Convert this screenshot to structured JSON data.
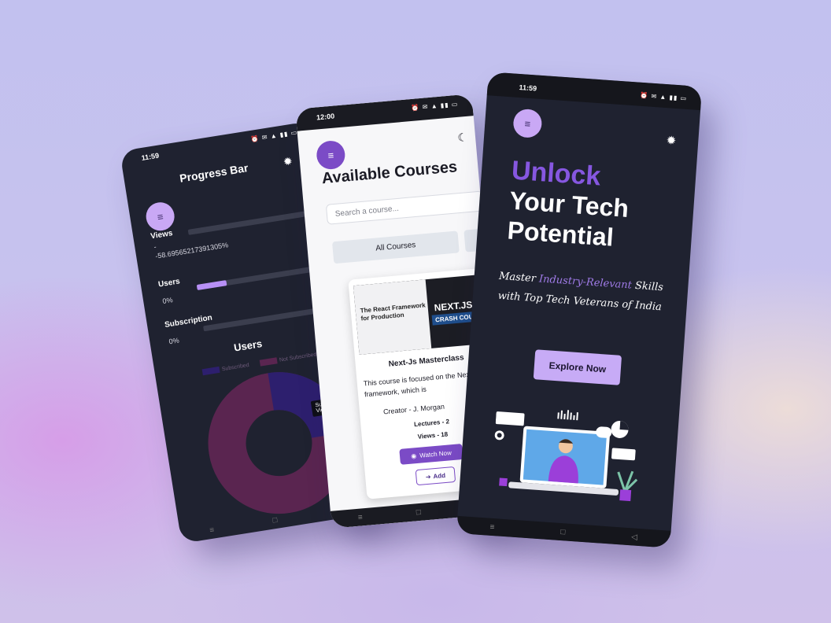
{
  "progress_phone": {
    "time": "11:59",
    "status_icons": "⏰ ✉ ▲ ▮▮ ▭",
    "title": "Progress Bar",
    "menu_icon": "≡",
    "gear_icon": "✹",
    "metrics": [
      {
        "label": "Views",
        "value_text": "-58.69565217391305%",
        "dash": "-",
        "max": "100",
        "fill_fraction": 0.0
      },
      {
        "label": "Users",
        "value_text": "0%",
        "max": "10",
        "fill_fraction": 0.25
      },
      {
        "label": "Subscription",
        "value_text": "0%",
        "max": "1",
        "fill_fraction": 0.0
      }
    ],
    "chart": {
      "title": "Users",
      "legend": [
        "Subscribed",
        "Not Subscribed"
      ],
      "tooltip_title": "Subscribed",
      "tooltip_item": "Viewed",
      "colors": {
        "subscribed": "#2d1f6e",
        "not_subscribed": "#5a2550"
      }
    },
    "nav": [
      "≡",
      "□",
      "◁"
    ]
  },
  "courses_phone": {
    "time": "12:00",
    "status_icons": "⏰ ✉ ▲ ▮▮ ▭",
    "menu_icon": "≡",
    "moon_icon": "☾",
    "heading": "Available Courses",
    "search_placeholder": "Search a course...",
    "tab_all": "All Courses",
    "card": {
      "thumb_left": "The React Framework for Production",
      "thumb_right1": "NEXT.JS",
      "thumb_right2": "CRASH COURSE",
      "title": "Next-Js Masterclass",
      "desc": "This course is focused on the Next.js framework, which is",
      "creator": "Creator -  J. Morgan",
      "lectures": "Lectures - 2",
      "views": "Views - 18",
      "watch": "Watch Now",
      "add": "Add"
    },
    "nav": [
      "≡",
      "□",
      "◁"
    ]
  },
  "hero_phone": {
    "time": "11:59",
    "status_icons": "⏰ ✉ ▲ ▮▮ ▭",
    "menu_icon": "≡",
    "gear_icon": "✹",
    "line1": "Unlock",
    "line2": "Your Tech Potential",
    "tag_pre": "Master ",
    "tag_hl": "Industry-Relevant",
    "tag_post": "Skills with Top Tech Veterans of India",
    "cta": "Explore Now",
    "accent": "#8657e0",
    "nav": [
      "≡",
      "□",
      "◁"
    ]
  }
}
